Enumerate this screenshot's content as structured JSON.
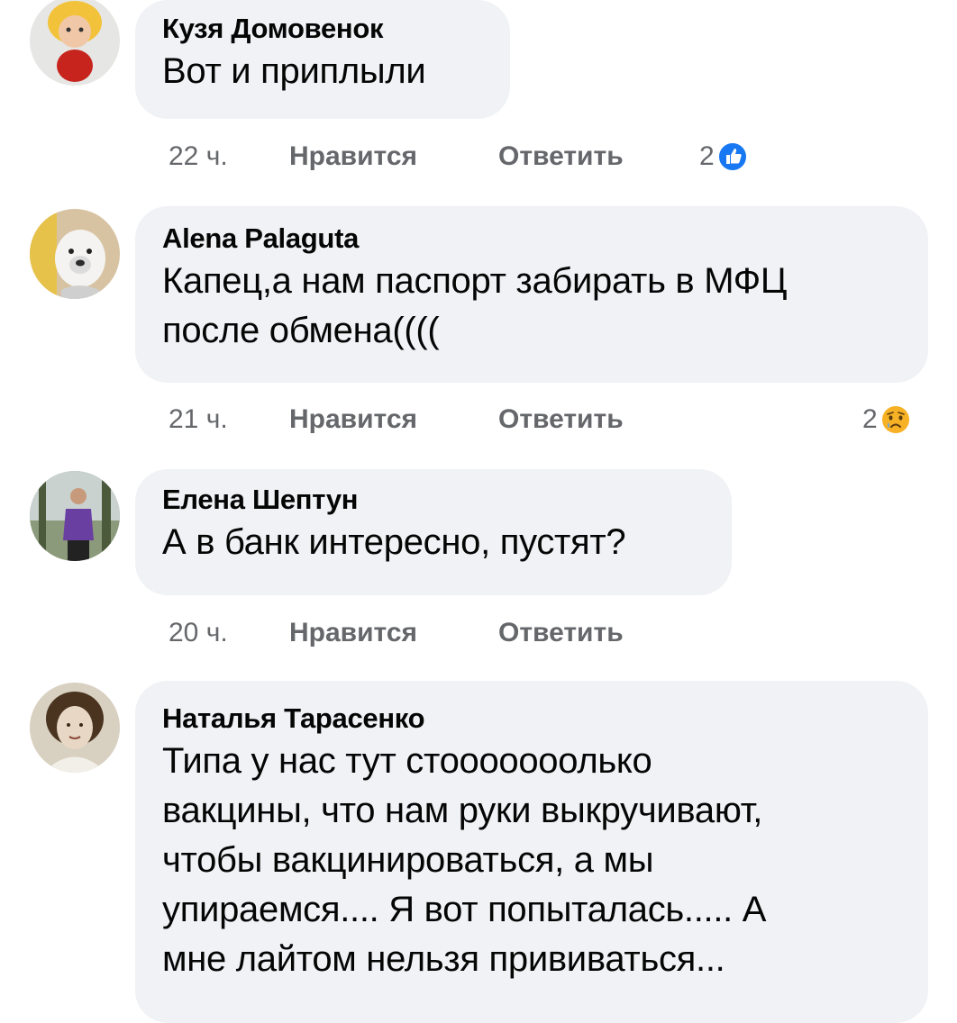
{
  "comments": [
    {
      "author": "Кузя Домовенок",
      "text": "Вот и приплыли",
      "time": "22 ч.",
      "like_label": "Нравится",
      "reply_label": "Ответить",
      "reaction_count": "2",
      "reaction_icon": "like-icon"
    },
    {
      "author": "Alena Palaguta",
      "text_lines": [
        "Капец,а нам паспорт забирать в МФЦ",
        "после обмена(((("
      ],
      "time": "21 ч.",
      "like_label": "Нравится",
      "reply_label": "Ответить",
      "reaction_count": "2",
      "reaction_icon": "sad-icon"
    },
    {
      "author": "Елена Шептун",
      "text": "А в банк интересно, пустят?",
      "time": "20 ч.",
      "like_label": "Нравится",
      "reply_label": "Ответить"
    },
    {
      "author": "Наталья Тарасенко",
      "text_lines": [
        "Типа у нас тут стооооооолько",
        "вакцины, что нам руки выкручивают,",
        "чтобы вакцинироваться, а мы",
        "упираемся.... Я вот попыталась..... А",
        "мне лайтом нельзя прививаться..."
      ]
    }
  ],
  "colors": {
    "bubble": "#f0f2f5",
    "meta_text": "#65676b",
    "like_blue": "#1877f2",
    "sad_yellow": "#f7b125"
  }
}
